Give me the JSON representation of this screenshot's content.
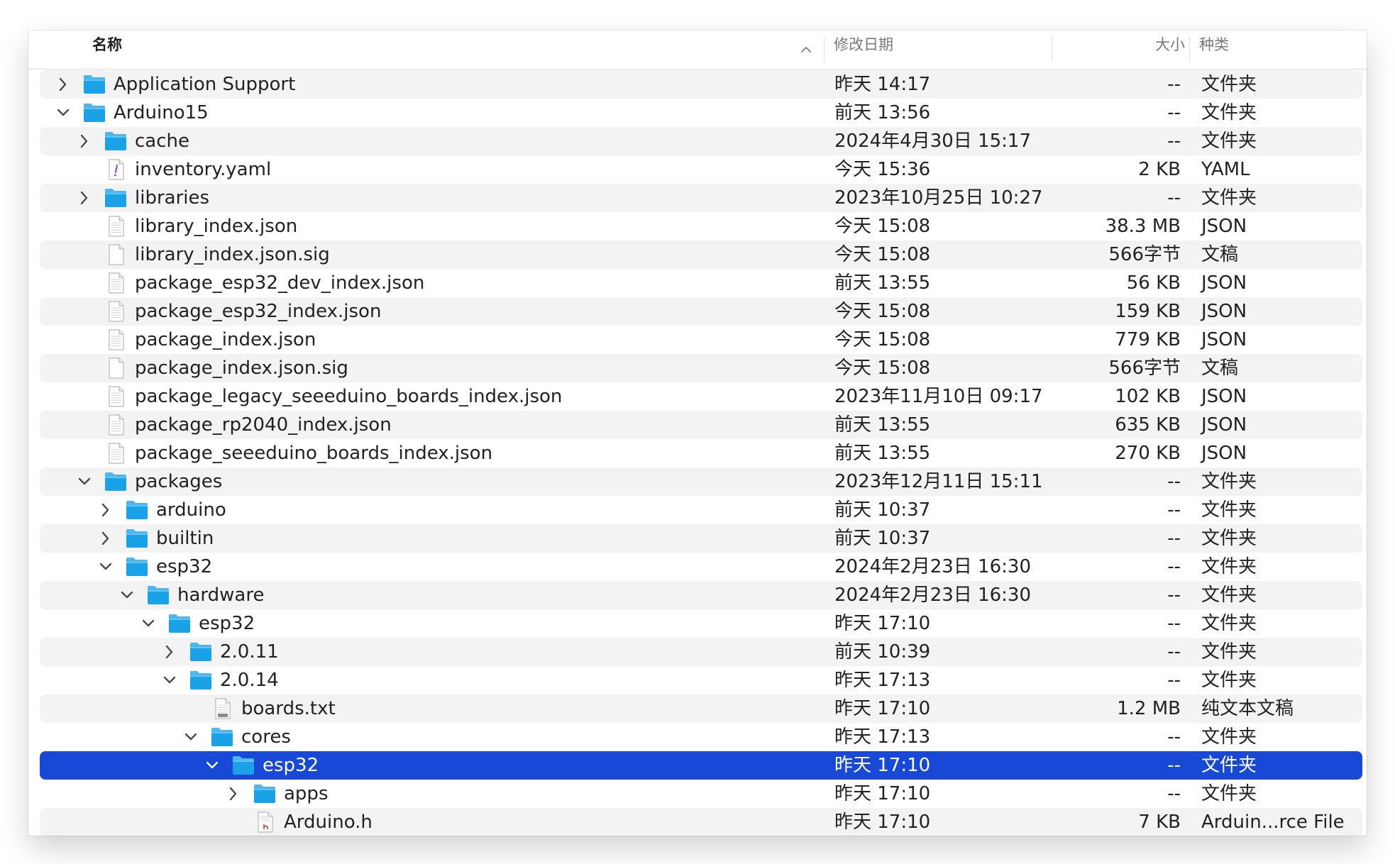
{
  "columns": {
    "name": "名称",
    "date": "修改日期",
    "size": "大小",
    "kind": "种类"
  },
  "colors": {
    "accent": "#1849d6",
    "folder": "#1aa2e8",
    "stripe": "#f3f3f3"
  },
  "rows": [
    {
      "name": "Application Support",
      "date": "昨天 14:17",
      "size": "--",
      "kind": "文件夹",
      "level": 0,
      "icon": "folder-icon",
      "disclosure": "collapsed"
    },
    {
      "name": "Arduino15",
      "date": "前天 13:56",
      "size": "--",
      "kind": "文件夹",
      "level": 0,
      "icon": "folder-icon",
      "disclosure": "expanded"
    },
    {
      "name": "cache",
      "date": "2024年4月30日 15:17",
      "size": "--",
      "kind": "文件夹",
      "level": 1,
      "icon": "folder-icon",
      "disclosure": "collapsed"
    },
    {
      "name": "inventory.yaml",
      "date": "今天 15:36",
      "size": "2 KB",
      "kind": "YAML",
      "level": 1,
      "icon": "yaml-file-icon",
      "disclosure": "none"
    },
    {
      "name": "libraries",
      "date": "2023年10月25日 10:27",
      "size": "--",
      "kind": "文件夹",
      "level": 1,
      "icon": "folder-icon",
      "disclosure": "collapsed"
    },
    {
      "name": "library_index.json",
      "date": "今天 15:08",
      "size": "38.3 MB",
      "kind": "JSON",
      "level": 1,
      "icon": "json-file-icon",
      "disclosure": "none"
    },
    {
      "name": "library_index.json.sig",
      "date": "今天 15:08",
      "size": "566字节",
      "kind": "文稿",
      "level": 1,
      "icon": "blank-file-icon",
      "disclosure": "none"
    },
    {
      "name": "package_esp32_dev_index.json",
      "date": "前天 13:55",
      "size": "56 KB",
      "kind": "JSON",
      "level": 1,
      "icon": "json-file-icon",
      "disclosure": "none"
    },
    {
      "name": "package_esp32_index.json",
      "date": "今天 15:08",
      "size": "159 KB",
      "kind": "JSON",
      "level": 1,
      "icon": "json-file-icon",
      "disclosure": "none"
    },
    {
      "name": "package_index.json",
      "date": "今天 15:08",
      "size": "779 KB",
      "kind": "JSON",
      "level": 1,
      "icon": "json-file-icon",
      "disclosure": "none"
    },
    {
      "name": "package_index.json.sig",
      "date": "今天 15:08",
      "size": "566字节",
      "kind": "文稿",
      "level": 1,
      "icon": "blank-file-icon",
      "disclosure": "none"
    },
    {
      "name": "package_legacy_seeeduino_boards_index.json",
      "date": "2023年11月10日 09:17",
      "size": "102 KB",
      "kind": "JSON",
      "level": 1,
      "icon": "json-file-icon",
      "disclosure": "none"
    },
    {
      "name": "package_rp2040_index.json",
      "date": "前天 13:55",
      "size": "635 KB",
      "kind": "JSON",
      "level": 1,
      "icon": "json-file-icon",
      "disclosure": "none"
    },
    {
      "name": "package_seeeduino_boards_index.json",
      "date": "前天 13:55",
      "size": "270 KB",
      "kind": "JSON",
      "level": 1,
      "icon": "json-file-icon",
      "disclosure": "none"
    },
    {
      "name": "packages",
      "date": "2023年12月11日 15:11",
      "size": "--",
      "kind": "文件夹",
      "level": 1,
      "icon": "folder-icon",
      "disclosure": "expanded"
    },
    {
      "name": "arduino",
      "date": "前天 10:37",
      "size": "--",
      "kind": "文件夹",
      "level": 2,
      "icon": "folder-icon",
      "disclosure": "collapsed"
    },
    {
      "name": "builtin",
      "date": "前天 10:37",
      "size": "--",
      "kind": "文件夹",
      "level": 2,
      "icon": "folder-icon",
      "disclosure": "collapsed"
    },
    {
      "name": "esp32",
      "date": "2024年2月23日 16:30",
      "size": "--",
      "kind": "文件夹",
      "level": 2,
      "icon": "folder-icon",
      "disclosure": "expanded"
    },
    {
      "name": "hardware",
      "date": "2024年2月23日 16:30",
      "size": "--",
      "kind": "文件夹",
      "level": 3,
      "icon": "folder-icon",
      "disclosure": "expanded"
    },
    {
      "name": "esp32",
      "date": "昨天 17:10",
      "size": "--",
      "kind": "文件夹",
      "level": 4,
      "icon": "folder-icon",
      "disclosure": "expanded"
    },
    {
      "name": "2.0.11",
      "date": "前天 10:39",
      "size": "--",
      "kind": "文件夹",
      "level": 5,
      "icon": "folder-icon",
      "disclosure": "collapsed"
    },
    {
      "name": "2.0.14",
      "date": "昨天 17:13",
      "size": "--",
      "kind": "文件夹",
      "level": 5,
      "icon": "folder-icon",
      "disclosure": "expanded"
    },
    {
      "name": "boards.txt",
      "date": "昨天 17:10",
      "size": "1.2 MB",
      "kind": "纯文本文稿",
      "level": 6,
      "icon": "text-file-icon",
      "disclosure": "none"
    },
    {
      "name": "cores",
      "date": "昨天 17:13",
      "size": "--",
      "kind": "文件夹",
      "level": 6,
      "icon": "folder-icon",
      "disclosure": "expanded"
    },
    {
      "name": "esp32",
      "date": "昨天 17:10",
      "size": "--",
      "kind": "文件夹",
      "level": 7,
      "icon": "folder-icon",
      "disclosure": "expanded",
      "selected": true
    },
    {
      "name": "apps",
      "date": "昨天 17:10",
      "size": "--",
      "kind": "文件夹",
      "level": 8,
      "icon": "folder-icon",
      "disclosure": "collapsed"
    },
    {
      "name": "Arduino.h",
      "date": "昨天 17:10",
      "size": "7 KB",
      "kind": "Arduin...rce File",
      "level": 8,
      "icon": "header-file-icon",
      "disclosure": "none"
    }
  ]
}
